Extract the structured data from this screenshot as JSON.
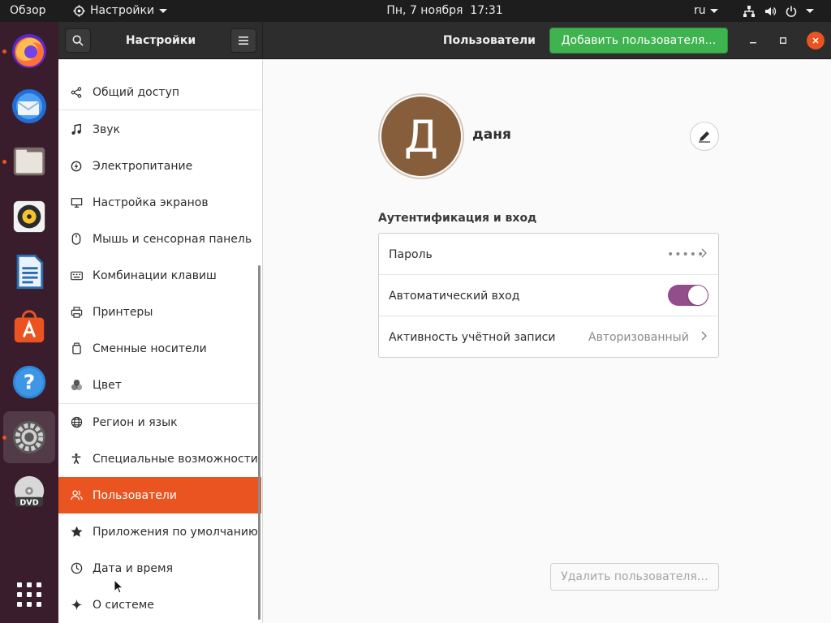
{
  "topbar": {
    "overview": "Обзор",
    "app_name": "Настройки",
    "clock": "Пн, 7 ноября  17:31",
    "lang": "ru"
  },
  "dock": {
    "items": [
      {
        "name": "firefox-icon",
        "running": true
      },
      {
        "name": "thunderbird-icon",
        "running": false
      },
      {
        "name": "files-icon",
        "running": true
      },
      {
        "name": "rhythmbox-icon",
        "running": false
      },
      {
        "name": "libreoffice-writer-icon",
        "running": false
      },
      {
        "name": "ubuntu-software-icon",
        "running": false
      },
      {
        "name": "help-icon",
        "running": false
      },
      {
        "name": "settings-icon",
        "running": true
      },
      {
        "name": "dvd-icon",
        "running": false
      },
      {
        "name": "show-apps-icon",
        "running": false
      }
    ]
  },
  "headerbar": {
    "left_title": "Настройки",
    "right_title": "Пользователи",
    "add_user": "Добавить пользователя…"
  },
  "sidebar": {
    "items": [
      {
        "label": "Общий доступ",
        "icon": "share-icon"
      },
      {
        "label": "Звук",
        "icon": "music-note-icon"
      },
      {
        "label": "Электропитание",
        "icon": "power-icon"
      },
      {
        "label": "Настройка экранов",
        "icon": "display-icon"
      },
      {
        "label": "Мышь и сенсорная панель",
        "icon": "mouse-icon"
      },
      {
        "label": "Комбинации клавиш",
        "icon": "keyboard-icon"
      },
      {
        "label": "Принтеры",
        "icon": "printer-icon"
      },
      {
        "label": "Сменные носители",
        "icon": "removable-media-icon"
      },
      {
        "label": "Цвет",
        "icon": "color-icon"
      },
      {
        "label": "Регион и язык",
        "icon": "globe-icon"
      },
      {
        "label": "Специальные возможности",
        "icon": "accessibility-icon"
      },
      {
        "label": "Пользователи",
        "icon": "users-icon"
      },
      {
        "label": "Приложения по умолчанию",
        "icon": "star-icon"
      },
      {
        "label": "Дата и время",
        "icon": "clock-icon"
      },
      {
        "label": "О системе",
        "icon": "sparkle-icon"
      }
    ],
    "selected": "Пользователи"
  },
  "user": {
    "avatar_letter": "Д",
    "avatar_color": "#865e3c",
    "name": "даня"
  },
  "auth": {
    "heading": "Аутентификация и вход",
    "password_label": "Пароль",
    "password_value": "•••••",
    "autologin_label": "Автоматический вход",
    "autologin_on": true,
    "activity_label": "Активность учётной записи",
    "activity_value": "Авторизованный"
  },
  "remove_user": "Удалить пользователя…",
  "colors": {
    "accent": "#e95420",
    "toggle": "#924d8b",
    "add_button": "#3eb34f"
  }
}
